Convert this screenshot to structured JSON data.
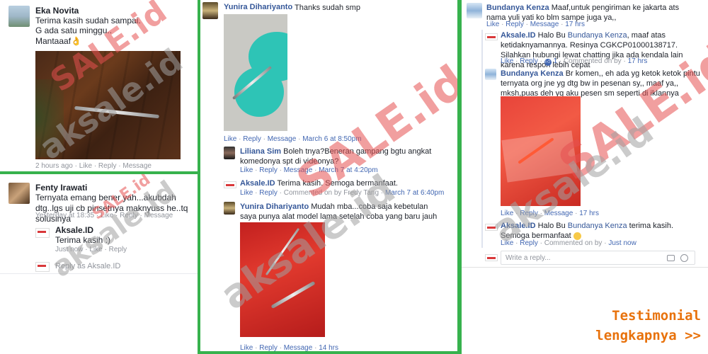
{
  "panel1": {
    "name": "Eka Novita",
    "line1": "Terima kasih sudah sampai.",
    "line2": "G ada satu minggu..",
    "line3": "Mantaaaf👌",
    "cut_actions": "2 hours ago · Like · Reply · Message"
  },
  "panel2": {
    "name": "Fenty Irawati",
    "text": "Ternyata emang bener yah...akubdah dtg..lgs uji cb pinsetnya maknyuss he..tq solusinya",
    "meta_time": "Yesterday at 18:35",
    "meta_like": "Like",
    "meta_reply": "Reply",
    "meta_message": "Message",
    "reply_name": "Aksale.ID",
    "reply_text": "Terima kasih :)",
    "reply_time": "Just now",
    "reply_like": "Like",
    "reply_reply": "Reply",
    "reply_as": "Reply as Aksale.ID"
  },
  "panel3": {
    "c1_name": "Yunira Dihariyanto",
    "c1_text": "Thanks sudah smp",
    "c1_like": "Like",
    "c1_reply": "Reply",
    "c1_message": "Message",
    "c1_time": "March 6 at 8:50pm",
    "c2_name": "Liliana Sim",
    "c2_text": "Boleh tnya?Beneran gampang bgtu angkat komedonya spt di videonya?",
    "c2_like": "Like",
    "c2_reply": "Reply",
    "c2_message": "Message",
    "c2_time": "March 7 at 4:20pm",
    "c3_name": "Aksale.ID",
    "c3_text": "Terima kasih. Semoga bermanfaat.",
    "c3_like": "Like",
    "c3_reply": "Reply",
    "c3_commented": "Commented on by Fredy Tang",
    "c3_time": "March 7 at 6:40pm",
    "c4_name": "Yunira Dihariyanto",
    "c4_text": "Mudah mba...coba saja kebetulan saya punya alat model lama setelah coba yang baru jauh lebih mudah dari pada",
    "c4_like": "Like",
    "c4_reply": "Reply",
    "c4_message": "Message",
    "c4_time": "14 hrs"
  },
  "panel4": {
    "c1_name": "Bundanya Kenza",
    "c1_text": "Maaf,untuk pengiriman ke jakarta ats nama yuli yati ko blm sampe juga ya,,",
    "c1_like": "Like",
    "c1_reply": "Reply",
    "c1_message": "Message",
    "c1_time": "17 hrs",
    "c2_name": "Aksale.ID",
    "c2_text_prefix": "Halo Bu ",
    "c2_mention": "Bundanya Kenza",
    "c2_text": ", maaf atas ketidaknyamannya. Resinya CGKCP01000138717. Silahkan hubungi lewat chatting jika ada kendala lain karena respon lebih cepat",
    "c2_like": "Like",
    "c2_reply": "Reply",
    "c2_count": "1",
    "c2_commented": "Commented on by",
    "c2_time": "17 hrs",
    "c3_name": "Bundanya Kenza",
    "c3_text": "Br komen,, eh ada yg ketok ketok pintu ternyata org jne yg dtg bw in pesenan sy,, maaf ya,, mksh,puas deh yg aku pesen sm seperti di iklannya",
    "c3_like": "Like",
    "c3_reply": "Reply",
    "c3_message": "Message",
    "c3_time": "17 hrs",
    "c4_name": "Aksale.ID",
    "c4_text_prefix": "Halo Bu ",
    "c4_mention": "Bundanya Kenza",
    "c4_text": " terima kasih. Semoga bermanfaat",
    "c4_like": "Like",
    "c4_reply": "Reply",
    "c4_commented": "Commented on by",
    "c4_time": "Just now",
    "reply_placeholder": "Write a reply..."
  },
  "cta": {
    "line1": "Testimonial",
    "line2": "lengkapnya >>"
  },
  "watermark": {
    "brand": "aksale.id",
    "sale": "SALE.id"
  },
  "colors": {
    "accent_green": "#37b24d",
    "link_blue": "#4267b2",
    "cta_orange": "#e8720c"
  }
}
